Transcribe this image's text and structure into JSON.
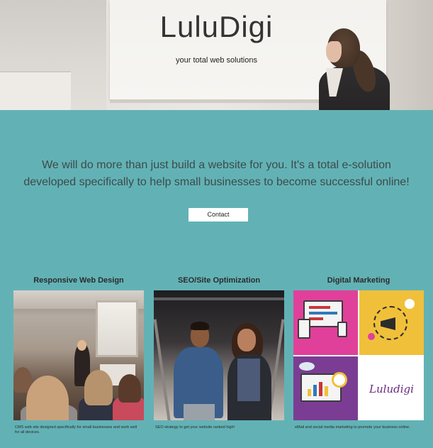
{
  "hero": {
    "title": "LuluDigi",
    "subtitle": "your total web solutions"
  },
  "intro": {
    "text": "We will do more than just build a website for you. It's a total e-solution developed specifically to help small businesses to become successful online!",
    "contact_label": "Contact"
  },
  "services": [
    {
      "title": "Responsive Web Design",
      "description": "CMS web site designed specifically for small businesses and work well for all devices."
    },
    {
      "title": "SEO/Site Optimization",
      "description": "SEO strategy to get your website ranked high!"
    },
    {
      "title": "Digital Marketing",
      "description": "eMail and social media marketing to promote your business online."
    }
  ],
  "logo_text": "Luludigi",
  "colors": {
    "background": "#62b2b5",
    "button": "#ffffff",
    "text": "#3e4a4b"
  }
}
